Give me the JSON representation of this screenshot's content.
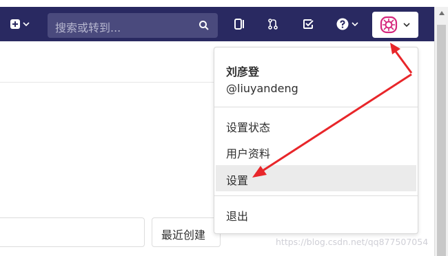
{
  "search": {
    "placeholder": "搜索或转到..."
  },
  "user_menu": {
    "name": "刘彦登",
    "handle": "@liuyandeng",
    "items": [
      {
        "label": "设置状态"
      },
      {
        "label": "用户资料"
      },
      {
        "label": "设置",
        "highlighted": true
      },
      {
        "label": "退出"
      }
    ]
  },
  "sort": {
    "selected": "最近创建"
  },
  "watermark": "https://blog.csdn.net/qq877507054",
  "colors": {
    "navbar": "#292961",
    "search_bg": "#4a4a7d",
    "annotation_arrow": "#e8262a",
    "avatar_accent": "#d5257c"
  }
}
